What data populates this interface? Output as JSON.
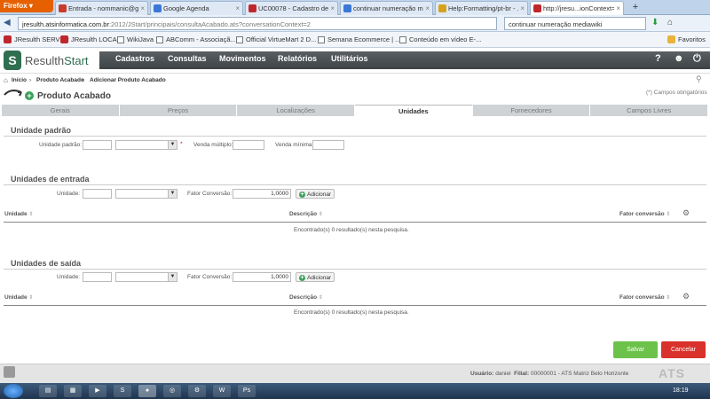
{
  "browser": {
    "app_button": "Firefox",
    "tabs": [
      {
        "label": "Entrada - nommanic@g...",
        "color": "#c83b2a",
        "active": false
      },
      {
        "label": "Google Agenda",
        "color": "#3b77d6",
        "active": false
      },
      {
        "label": "UC00078 - Cadastro de p...",
        "color": "#c0272d",
        "active": false
      },
      {
        "label": "continuar numeração m...",
        "color": "#3b77d6",
        "active": false
      },
      {
        "label": "Help:Formatting/pt-br - ...",
        "color": "#d6a21e",
        "active": false
      },
      {
        "label": "http://jresu...ionContext=2",
        "color": "#c0272d",
        "active": true
      }
    ],
    "new_tab": "+",
    "url_domain": "jresulth.atsinformatica.com.br",
    "url_rest": ":2012/JStart/principais/consultaAcabado.ats?conversationContext=2",
    "search_value": "continuar numeração mediawiki",
    "bookmarks": [
      "JResulth SERVER",
      "JResulth LOCAL",
      "WikiJava",
      "ABComm - Associaçã...",
      "Official VirtueMart 2 D...",
      "Semana Ecommerce | ...",
      "Conteúdo em vídeo E-..."
    ],
    "bookmarks_menu": "Favoritos"
  },
  "app": {
    "logo_letter": "S",
    "brand_a": "Resulth",
    "brand_b": "Start",
    "menu": [
      "Cadastros",
      "Consultas",
      "Movimentos",
      "Relatórios",
      "Utilitários"
    ],
    "icons": [
      "help-icon",
      "user-icon",
      "power-icon"
    ],
    "help_glyph": "?"
  },
  "breadcrumb": [
    "Início",
    "Produto Acabado",
    "Adicionar Produto Acabado"
  ],
  "page_title": "Produto Acabado",
  "required_note": "(*) Campos obrigatórios",
  "tabs": [
    {
      "label": "Gerais",
      "active": false
    },
    {
      "label": "Preços",
      "active": false
    },
    {
      "label": "Localizações",
      "active": false
    },
    {
      "label": "Unidades",
      "active": true
    },
    {
      "label": "Fornecedores",
      "active": false
    },
    {
      "label": "Campos Livres",
      "active": false
    }
  ],
  "unidade_padrao": {
    "title": "Unidade padrão",
    "label_unidade": "Unidade padrão:",
    "required_mark": "*",
    "label_multiplo": "Venda múltiplo:",
    "label_minima": "Venda mínima:"
  },
  "unidades_entrada": {
    "title": "Unidades de entrada",
    "label_unidade": "Unidade:",
    "label_fator": "Fator Conversão:",
    "fator_value": "1,0000",
    "add_label": "Adicionar",
    "columns": [
      "Unidade",
      "Descrição",
      "Fator conversão"
    ],
    "empty": "Encontrado(s) 0 resultado(s) nesta pesquisa."
  },
  "unidades_saida": {
    "title": "Unidades de saída",
    "label_unidade": "Unidade:",
    "label_fator": "Fator Conversão:",
    "fator_value": "1,0000",
    "add_label": "Adicionar",
    "columns": [
      "Unidade",
      "Descrição",
      "Fator conversão"
    ],
    "empty": "Encontrado(s) 0 resultado(s) nesta pesquisa."
  },
  "actions": {
    "save": "Salvar",
    "cancel": "Cancelar"
  },
  "status": {
    "user_label": "Usuário:",
    "user": "daniel",
    "branch_label": "Filial:",
    "branch": "00000001 - ATS Matriz Belo Horizonte",
    "logo": "ATS"
  },
  "taskbar": {
    "clock": "18:19"
  }
}
